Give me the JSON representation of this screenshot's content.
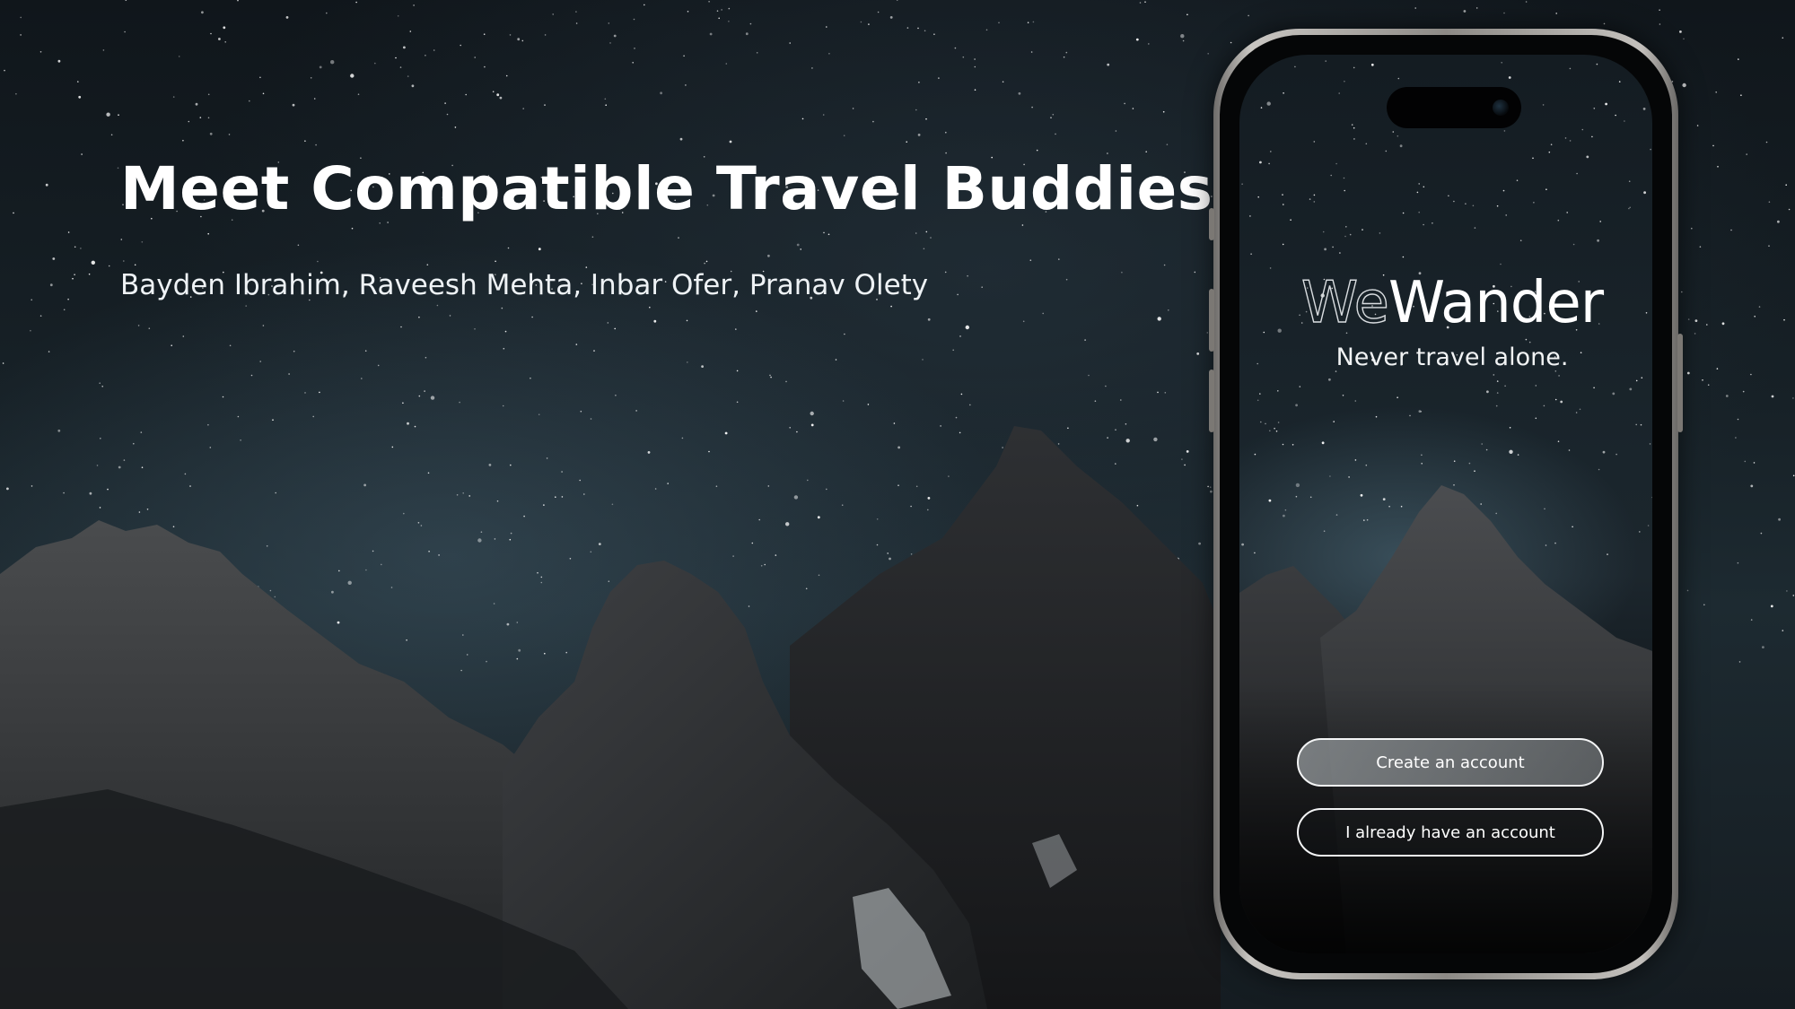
{
  "slide": {
    "title": "Meet Compatible Travel Buddies",
    "authors": "Bayden Ibrahim, Raveesh Mehta, Inbar Ofer, Pranav Olety"
  },
  "app": {
    "logo_we": "We",
    "logo_wander": "Wander",
    "tagline": "Never travel alone.",
    "create_account_label": "Create an account",
    "login_label": "I already have an account"
  },
  "colors": {
    "sky": "#172127",
    "mountain": "#34373a",
    "text": "#ffffff",
    "button_border": "#f4f5f6"
  }
}
